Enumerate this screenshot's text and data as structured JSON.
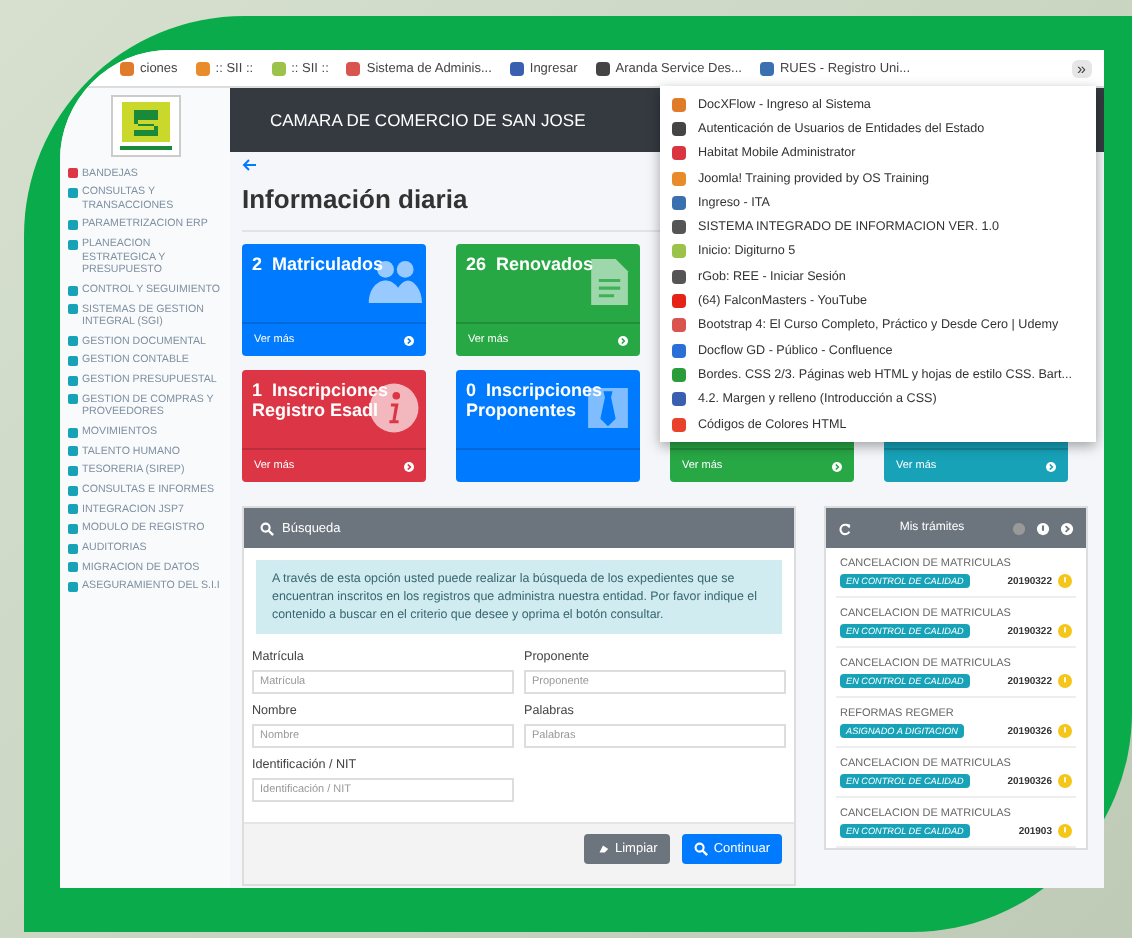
{
  "bookmarks": [
    {
      "label": "ciones"
    },
    {
      "label": ":: SII ::"
    },
    {
      "label": ":: SII ::"
    },
    {
      "label": "Sistema de Adminis..."
    },
    {
      "label": "Ingresar"
    },
    {
      "label": "Aranda Service Des..."
    },
    {
      "label": "RUES - Registro Uni..."
    }
  ],
  "bookmarks_more": "»",
  "bookmarks_menu": [
    "DocXFlow - Ingreso al Sistema",
    "Autenticación de Usuarios de Entidades del Estado",
    "Habitat Mobile Administrator",
    "Joomla! Training provided by OS Training",
    "Ingreso - ITA",
    "SISTEMA INTEGRADO DE INFORMACION VER. 1.0",
    "Inicio: Digiturno 5",
    "rGob: REE - Iniciar Sesión",
    "(64) FalconMasters - YouTube",
    "Bootstrap 4: El Curso Completo, Práctico y Desde Cero | Udemy",
    "Docflow GD - Público - Confluence",
    "Bordes. CSS 2/3. Páginas web HTML y hojas de estilo CSS. Bart...",
    "4.2. Margen y relleno (Introducción a CSS)",
    "Códigos de Colores HTML"
  ],
  "header": {
    "title": "CAMARA DE COMERCIO DE SAN JOSE"
  },
  "sidebar": {
    "items": [
      {
        "label": "BANDEJAS",
        "color": "#dc3545"
      },
      {
        "label": "CONSULTAS Y TRANSACCIONES",
        "color": "#17a2b8"
      },
      {
        "label": "PARAMETRIZACION ERP",
        "color": "#17a2b8"
      },
      {
        "label": "PLANEACION ESTRATEGICA Y PRESUPUESTO",
        "color": "#17a2b8"
      },
      {
        "label": "CONTROL Y SEGUIMIENTO",
        "color": "#17a2b8"
      },
      {
        "label": "SISTEMAS DE GESTION INTEGRAL (SGI)",
        "color": "#17a2b8"
      },
      {
        "label": "GESTION DOCUMENTAL",
        "color": "#17a2b8"
      },
      {
        "label": "GESTION CONTABLE",
        "color": "#17a2b8"
      },
      {
        "label": "GESTION PRESUPUESTAL",
        "color": "#17a2b8"
      },
      {
        "label": "GESTION DE COMPRAS Y PROVEEDORES",
        "color": "#17a2b8"
      },
      {
        "label": "MOVIMIENTOS",
        "color": "#17a2b8"
      },
      {
        "label": "TALENTO HUMANO",
        "color": "#17a2b8"
      },
      {
        "label": "TESORERIA (SIREP)",
        "color": "#17a2b8"
      },
      {
        "label": "CONSULTAS E INFORMES",
        "color": "#17a2b8"
      },
      {
        "label": "INTEGRACION JSP7",
        "color": "#17a2b8"
      },
      {
        "label": "MODULO DE REGISTRO",
        "color": "#17a2b8"
      },
      {
        "label": "AUDITORIAS",
        "color": "#17a2b8"
      },
      {
        "label": "MIGRACION DE DATOS",
        "color": "#17a2b8"
      },
      {
        "label": "ASEGURAMIENTO DEL S.I.I",
        "color": "#17a2b8"
      }
    ]
  },
  "page_title": "Información diaria",
  "card_rows": [
    [
      {
        "number": "2",
        "label": "Matriculados",
        "color": "#007bff",
        "footer": "Ver más"
      },
      {
        "number": "26",
        "label": "Renovados",
        "color": "#28a745",
        "footer": "Ver más"
      }
    ],
    [
      {
        "number": "1",
        "label": "Inscripciones Registro Esadl",
        "color": "#dc3545",
        "footer": "Ver más"
      },
      {
        "number": "0",
        "label": "Inscripciones Proponentes",
        "color": "#007bff"
      },
      {
        "color": "#28a745",
        "footer": "Ver más"
      },
      {
        "color": "#17a2b8",
        "footer": "Ver más"
      }
    ]
  ],
  "search": {
    "title": "Búsqueda",
    "info": "A través de esta opción usted puede realizar la búsqueda de los expedientes que se encuentran inscritos en los registros que administra nuestra entidad. Por favor indique el contenido a buscar en el criterio que desee y oprima el botón consultar.",
    "fields": [
      {
        "label": "Matrícula",
        "placeholder": "Matrícula"
      },
      {
        "label": "Proponente",
        "placeholder": "Proponente"
      },
      {
        "label": "Nombre",
        "placeholder": "Nombre"
      },
      {
        "label": "Palabras",
        "placeholder": "Palabras"
      },
      {
        "label": "Identificación / NIT",
        "placeholder": "Identificación / NIT"
      }
    ],
    "buttons": [
      {
        "label": "Limpiar",
        "kind": "secondary"
      },
      {
        "label": "Continuar",
        "kind": "primary"
      }
    ]
  },
  "tramites": {
    "title": "Mis trámites",
    "items": [
      {
        "title": "CANCELACION DE MATRICULAS",
        "status": "EN CONTROL DE CALIDAD",
        "date": "20190322"
      },
      {
        "title": "CANCELACION DE MATRICULAS",
        "status": "EN CONTROL DE CALIDAD",
        "date": "20190322"
      },
      {
        "title": "CANCELACION DE MATRICULAS",
        "status": "EN CONTROL DE CALIDAD",
        "date": "20190322"
      },
      {
        "title": "REFORMAS REGMER",
        "status": "ASIGNADO A DIGITACION",
        "date": "20190326"
      },
      {
        "title": "CANCELACION DE MATRICULAS",
        "status": "EN CONTROL DE CALIDAD",
        "date": "20190326"
      },
      {
        "title": "CANCELACION DE MATRICULAS",
        "status": "EN CONTROL DE CALIDAD",
        "date": "201903"
      }
    ]
  }
}
